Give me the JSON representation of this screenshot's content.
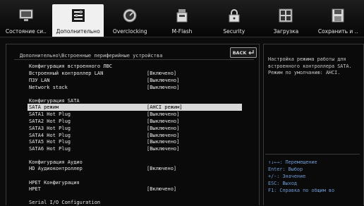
{
  "tabs": [
    {
      "label": "Состояние си..",
      "icon": "monitor-icon"
    },
    {
      "label": "Дополнительно",
      "icon": "settings-list-icon"
    },
    {
      "label": "Overclocking",
      "icon": "speedometer-icon"
    },
    {
      "label": "M-Flash",
      "icon": "usb-flash-icon"
    },
    {
      "label": "Security",
      "icon": "lock-icon"
    },
    {
      "label": "Загрузка",
      "icon": "boot-icon"
    },
    {
      "label": "Сохранить и ..",
      "icon": "save-icon"
    }
  ],
  "active_tab": "Дополнительно",
  "back_label": "BACK",
  "breadcrumb": "Дополнительно\\Встроенные периферийные устройства",
  "settings": {
    "lan_section": "Конфигурация встроенного ЛВС",
    "lan_controller": {
      "name": "Встроенный контроллер LAN",
      "value": "[Включено]"
    },
    "lan_rom": {
      "name": "ПЗУ LAN",
      "value": "[Выключено]"
    },
    "network_stack": {
      "name": "Network stack",
      "value": "[Выключено]"
    },
    "sata_section": "Конфигурация SATA",
    "sata_mode": {
      "name": "SATA режим",
      "value": "[AHCI режим]"
    },
    "sata1": {
      "name": "SATA1 Hot Plug",
      "value": "[Выключено]"
    },
    "sata2": {
      "name": "SATA2 Hot Plug",
      "value": "[Выключено]"
    },
    "sata3": {
      "name": "SATA3 Hot Plug",
      "value": "[Выключено]"
    },
    "sata4": {
      "name": "SATA4 Hot Plug",
      "value": "[Выключено]"
    },
    "sata5": {
      "name": "SATA5 Hot Plug",
      "value": "[Выключено]"
    },
    "sata6": {
      "name": "SATA6 Hot Plug",
      "value": "[Выключено]"
    },
    "audio_section": "Конфигурация Аудио",
    "hd_audio": {
      "name": "HD Аудиоконтроллер",
      "value": "[Включено]"
    },
    "hpet_section": "HPET Конфигурация",
    "hpet": {
      "name": "HPET",
      "value": "[Включено]"
    },
    "serial_section": "Serial I/O Configuration"
  },
  "help": {
    "text": "Настройка режима работы для встроенного контроллера SATA. Режим по умолчанию: AHCI.",
    "keys": [
      "↑↓←→: Перемещение",
      "Enter: Выбор",
      "+/-: Значение",
      "ESC: Выход",
      "F1: Справка по общим во"
    ]
  },
  "colors": {
    "accent_keys": "#6f9bd6",
    "active_tab_bg": "#f0f0f0",
    "selection_bg": "#d8d8d8"
  }
}
